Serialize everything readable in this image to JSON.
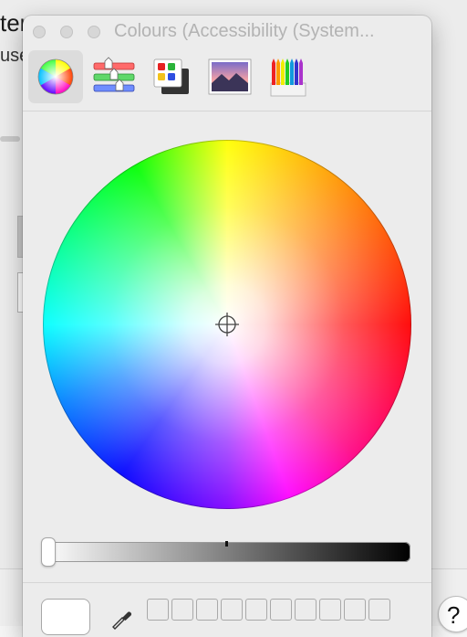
{
  "background": {
    "text_fragment_1": "ter",
    "text_fragment_2": "use",
    "help_label": "?"
  },
  "panel": {
    "title": "Colours (Accessibility (System...",
    "tabs": [
      {
        "name": "colour-wheel",
        "selected": true
      },
      {
        "name": "colour-sliders",
        "selected": false
      },
      {
        "name": "colour-palettes",
        "selected": false
      },
      {
        "name": "image-palettes",
        "selected": false
      },
      {
        "name": "pencils",
        "selected": false
      }
    ],
    "brightness_level": 1.0,
    "current_colour": "#ffffff",
    "swatch_slots": 10
  },
  "colors": {
    "panel_bg": "#ececec",
    "selected_tab_bg": "#dcdcdc"
  }
}
